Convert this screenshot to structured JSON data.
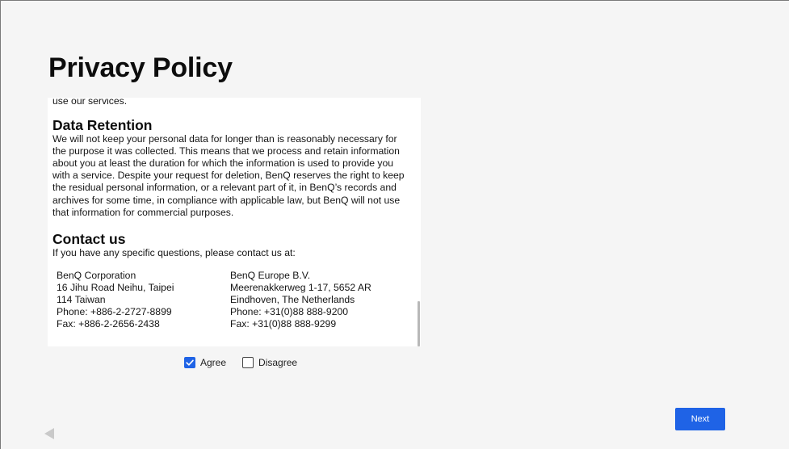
{
  "page": {
    "title": "Privacy Policy"
  },
  "policy": {
    "intro_tail": "use our services.",
    "retention": {
      "heading": "Data Retention",
      "lines": [
        "We will not keep your personal data for longer than is reasonably necessary for",
        "the purpose it was collected. This means that we process and retain information",
        "about you at least the duration for which the information is used to provide you",
        "with a service. Despite your request for deletion, BenQ reserves the right to keep",
        "the residual personal information, or a relevant part of it, in BenQ’s records and",
        "archives for some time, in compliance with applicable law, but BenQ will not use",
        "that information for commercial purposes."
      ]
    },
    "contact": {
      "heading": "Contact us",
      "intro": "If you have any specific questions, please contact us at:",
      "left_address": [
        "BenQ Corporation",
        "16 Jihu Road Neihu, Taipei",
        "114 Taiwan",
        "Phone: +886-2-2727-8899",
        "Fax: +886-2-2656-2438"
      ],
      "right_address": [
        "BenQ Europe B.V.",
        "Meerenakkerweg 1-17, 5652 AR",
        "Eindhoven, The Netherlands",
        "Phone: +31(0)88 888-9200",
        "Fax: +31(0)88 888-9299"
      ]
    }
  },
  "consent": {
    "agree_label": "Agree",
    "agree_checked": true,
    "disagree_label": "Disagree",
    "disagree_checked": false
  },
  "nav": {
    "next_label": "Next",
    "back_icon": "triangle-left-icon"
  },
  "colors": {
    "accent": "#1f63e6",
    "background": "#f5f5f5",
    "panel": "#ffffff"
  }
}
